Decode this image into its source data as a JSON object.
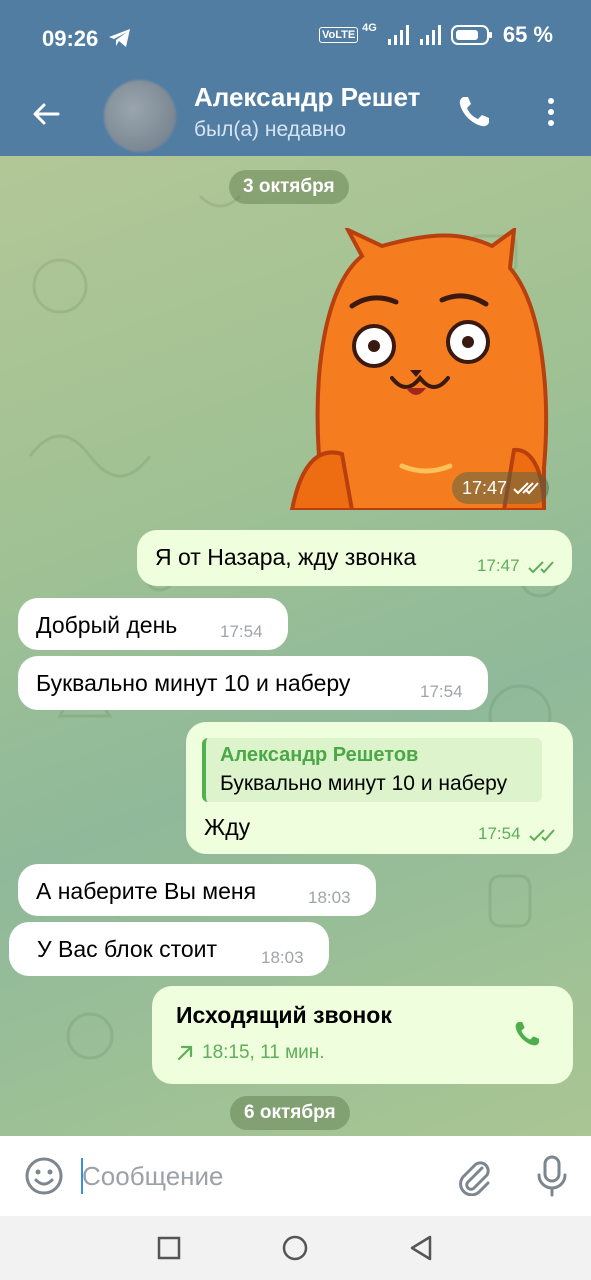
{
  "status_bar": {
    "time": "09:26",
    "volte": "VoLTE",
    "network": "4G",
    "battery": "65 %"
  },
  "header": {
    "contact_name": "Александр Решет",
    "status": "был(а) недавно"
  },
  "messages": {
    "date1": "3 октября",
    "sticker_time": "17:47",
    "m1": {
      "text": "Я от Назара, жду звонка",
      "time": "17:47"
    },
    "m2": {
      "text": "Добрый день",
      "time": "17:54"
    },
    "m3": {
      "text": "Буквально минут 10 и наберу",
      "time": "17:54"
    },
    "m4": {
      "reply_name": "Александр Решетов",
      "reply_text": "Буквально минут 10 и наберу",
      "text": "Жду",
      "time": "17:54"
    },
    "m5": {
      "text": "А наберите Вы меня",
      "time": "18:03"
    },
    "m6": {
      "text": "У Вас блок стоит",
      "time": "18:03"
    },
    "call": {
      "title": "Исходящий звонок",
      "info": "18:15, 11 мин."
    },
    "date2": "6 октября"
  },
  "composer": {
    "placeholder": "Сообщение"
  },
  "colors": {
    "header": "#527da3",
    "outgoing_bubble": "#effedd",
    "incoming_bubble": "#ffffff",
    "accent_green": "#5fae5a",
    "sticker_orange": "#f57c1f"
  }
}
